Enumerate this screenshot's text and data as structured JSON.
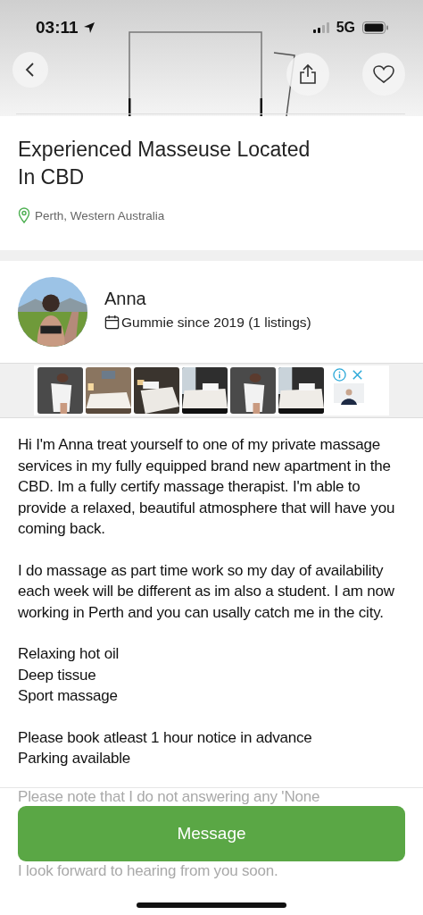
{
  "status_bar": {
    "time": "03:11",
    "network": "5G"
  },
  "listing": {
    "title": "Experienced Masseuse Located In CBD",
    "location": "Perth, Western Australia"
  },
  "seller": {
    "name": "Anna",
    "member_since": "Gummie since 2019 (1 listings)"
  },
  "description": {
    "paragraphs": [
      [
        "Hi I'm Anna treat yourself to one of my private massage services in my fully equipped brand new apartment in the CBD. Im a fully certify massage therapist. I'm able to provide a relaxed, beautiful atmosphere that will have you coming back."
      ],
      [
        "I do massage as part time work so my day of availability each week will be different as im also a student. I am now working in Perth and you can usally catch me in the city."
      ],
      [
        "Relaxing hot oil",
        "Deep tissue",
        "Sport massage"
      ],
      [
        "Please book atleast 1 hour notice in advance",
        "Parking available"
      ]
    ]
  },
  "footer": {
    "faded_before": "Please note that I do not answering any 'None",
    "button": "Message",
    "faded_after": "I look forward to hearing from you soon."
  }
}
